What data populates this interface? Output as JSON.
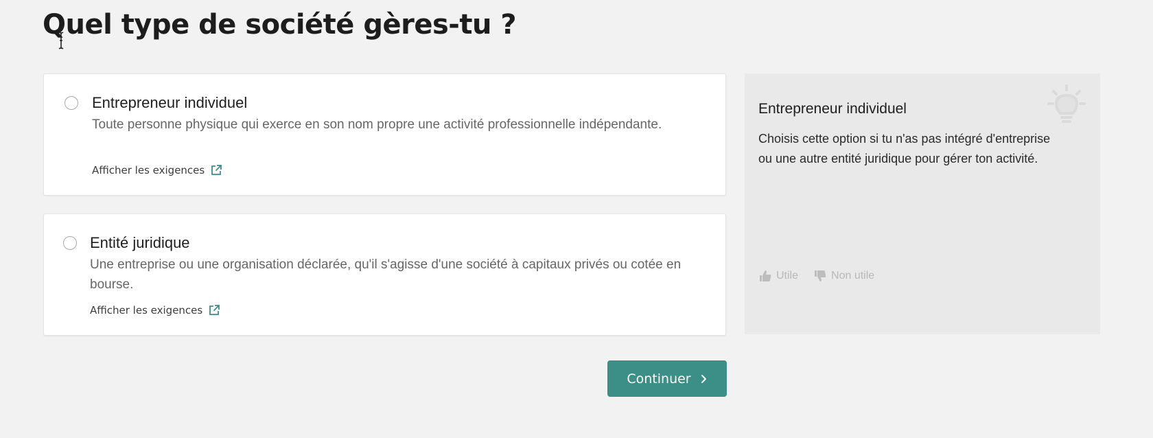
{
  "page": {
    "title": "Quel type de société gères-tu ?"
  },
  "options": [
    {
      "title": "Entrepreneur individuel",
      "description": "Toute personne physique qui exerce en son nom propre une activité professionnelle indépendante.",
      "link_label": "Afficher les exigences",
      "selected": false
    },
    {
      "title": "Entité juridique",
      "description": "Une entreprise ou une organisation déclarée, qu'il s'agisse d'une société à capitaux privés ou cotée en bourse.",
      "link_label": "Afficher les exigences",
      "selected": false
    }
  ],
  "info_panel": {
    "title": "Entrepreneur individuel",
    "text": "Choisis cette option si tu n'as pas intégré d'entreprise ou une autre entité juridique pour gérer ton activité.",
    "icon": "lightbulb-icon",
    "feedback": {
      "useful_label": "Utile",
      "not_useful_label": "Non utile"
    }
  },
  "actions": {
    "continue_label": "Continuer"
  },
  "colors": {
    "accent": "#3b8f86",
    "background": "#f2f2f2",
    "panel": "#e9e9e9"
  }
}
